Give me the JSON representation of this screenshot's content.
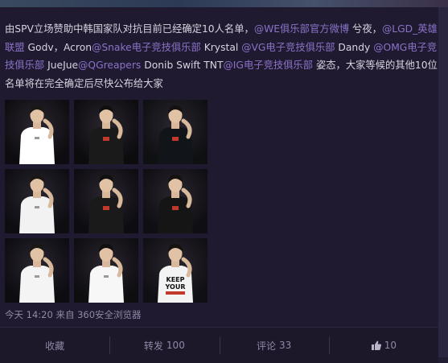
{
  "post": {
    "segments": [
      {
        "text": "由SPV立场赞助中韩国家队对抗目前已经确定10人名单，",
        "link": false
      },
      {
        "text": "@WE俱乐部官方微博",
        "link": true
      },
      {
        "text": " 兮夜，",
        "link": false
      },
      {
        "text": "@LGD_英雄联盟",
        "link": true
      },
      {
        "text": " Godv，Acron",
        "link": false
      },
      {
        "text": "@Snake电子竞技俱乐部",
        "link": true
      },
      {
        "text": " Krystal ",
        "link": false
      },
      {
        "text": "@VG电子竞技俱乐部",
        "link": true
      },
      {
        "text": " Dandy ",
        "link": false
      },
      {
        "text": "@OMG电子竞技俱乐部",
        "link": true
      },
      {
        "text": " JueJue",
        "link": false
      },
      {
        "text": "@QGreapers",
        "link": true
      },
      {
        "text": " Donib Swift TNT",
        "link": false
      },
      {
        "text": "@IG电子竞技俱乐部",
        "link": true
      },
      {
        "text": " 姿态，大家等候的其他10位名单将在完全确定后尽快公布给大家",
        "link": false
      }
    ]
  },
  "photos": [
    {
      "name": "player-photo-1",
      "shirt": "#ffffff",
      "bg": "#0e0c10"
    },
    {
      "name": "player-photo-2",
      "shirt": "#1a1a1a",
      "bg": "#0c0b0e"
    },
    {
      "name": "player-photo-3",
      "shirt": "#111418",
      "bg": "#0f1012"
    },
    {
      "name": "player-photo-4",
      "shirt": "#f2f2f2",
      "bg": "#0e0d12"
    },
    {
      "name": "player-photo-5",
      "shirt": "#1a1a1a",
      "bg": "#0d0c10"
    },
    {
      "name": "player-photo-6",
      "shirt": "#151515",
      "bg": "#0f0e12"
    },
    {
      "name": "player-photo-7",
      "shirt": "#f4f4f4",
      "bg": "#0d0c11"
    },
    {
      "name": "player-photo-8",
      "shirt": "#f7f7f7",
      "bg": "#0e0d10"
    },
    {
      "name": "player-photo-9",
      "shirt": "#f3f3f3",
      "bg": "#100f13"
    }
  ],
  "photo_text": {
    "shirt_slogan": [
      "KEEP",
      "YOUR"
    ]
  },
  "meta": {
    "time": "今天 14:20",
    "source_prefix": "来自",
    "source": "360安全浏览器"
  },
  "actions": {
    "favorite_label": "收藏",
    "repost_label": "转发",
    "repost_count": "100",
    "comment_label": "评论",
    "comment_count": "33",
    "like_count": "10"
  },
  "colors": {
    "background": "#1f1a30",
    "text": "#d7d4e0",
    "link": "#8b72c8",
    "muted": "#8f89a6"
  }
}
